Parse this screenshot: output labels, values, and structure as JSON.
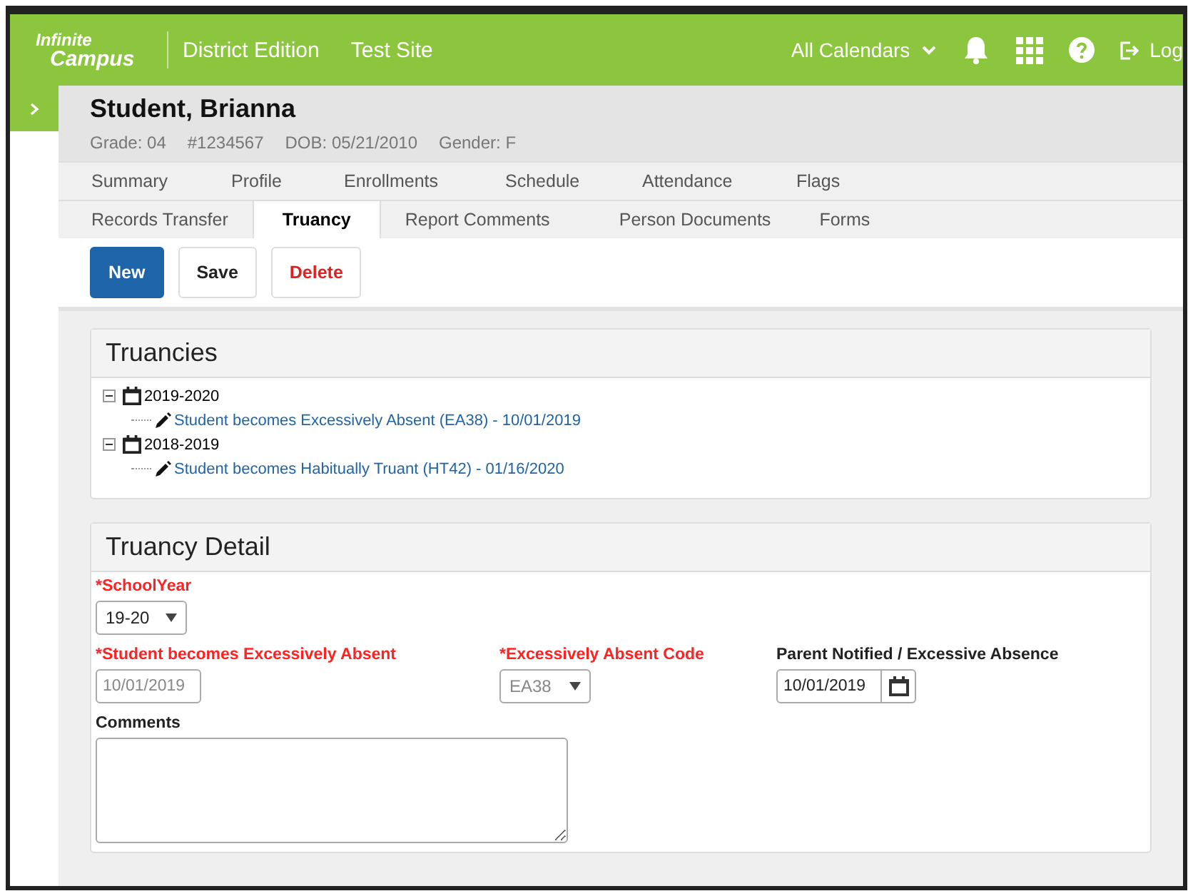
{
  "header": {
    "logo_top": "Infinite",
    "logo_bottom": "Campus",
    "edition": "District Edition",
    "site": "Test Site",
    "calendar": "All Calendars",
    "logout": "Log"
  },
  "student": {
    "name": "Student, Brianna",
    "details": [
      "Grade: 04",
      "#1234567",
      "DOB: 05/21/2010",
      "Gender: F"
    ]
  },
  "tab_rows": [
    [
      {
        "label": "Summary",
        "selected": false
      },
      {
        "label": "Profile",
        "selected": false
      },
      {
        "label": "Enrollments",
        "selected": false
      },
      {
        "label": "Schedule",
        "selected": false
      },
      {
        "label": "Attendance",
        "selected": false
      },
      {
        "label": "Flags",
        "selected": false
      }
    ],
    [
      {
        "label": "Records Transfer",
        "selected": false
      },
      {
        "label": "Truancy",
        "selected": true
      },
      {
        "label": "Report Comments",
        "selected": false
      },
      {
        "label": "Person Documents",
        "selected": false
      },
      {
        "label": "Forms",
        "selected": false
      }
    ]
  ],
  "buttons": [
    {
      "label": "New",
      "kind": "primary"
    },
    {
      "label": "Save",
      "kind": "default"
    },
    {
      "label": "Delete",
      "kind": "danger"
    }
  ],
  "truancies": {
    "title": "Truancies",
    "years": [
      {
        "label": "2019-2020",
        "expanded": true,
        "children": [
          {
            "label": "Student becomes Excessively Absent (EA38) - 10/01/2019"
          }
        ]
      },
      {
        "label": "2018-2019",
        "expanded": true,
        "children": [
          {
            "label": "Student becomes Habitually Truant (HT42) - 01/16/2020"
          }
        ]
      }
    ]
  },
  "detail": {
    "title": "Truancy Detail",
    "rows": [
      [
        {
          "label": "*SchoolYear",
          "required": true,
          "kind": "select",
          "value": "19-20",
          "disabled": false
        }
      ],
      [
        {
          "label": "*Student becomes Excessively Absent",
          "required": true,
          "kind": "date",
          "value": "10/01/2019",
          "disabled": true
        },
        {
          "label": "*Excessively Absent Code",
          "required": true,
          "kind": "select",
          "value": "EA38",
          "disabled": true
        },
        {
          "label": "Parent Notified / Excessive Absence",
          "required": false,
          "kind": "date-picker",
          "value": "10/01/2019",
          "disabled": false
        }
      ]
    ],
    "comments_label": "Comments"
  }
}
